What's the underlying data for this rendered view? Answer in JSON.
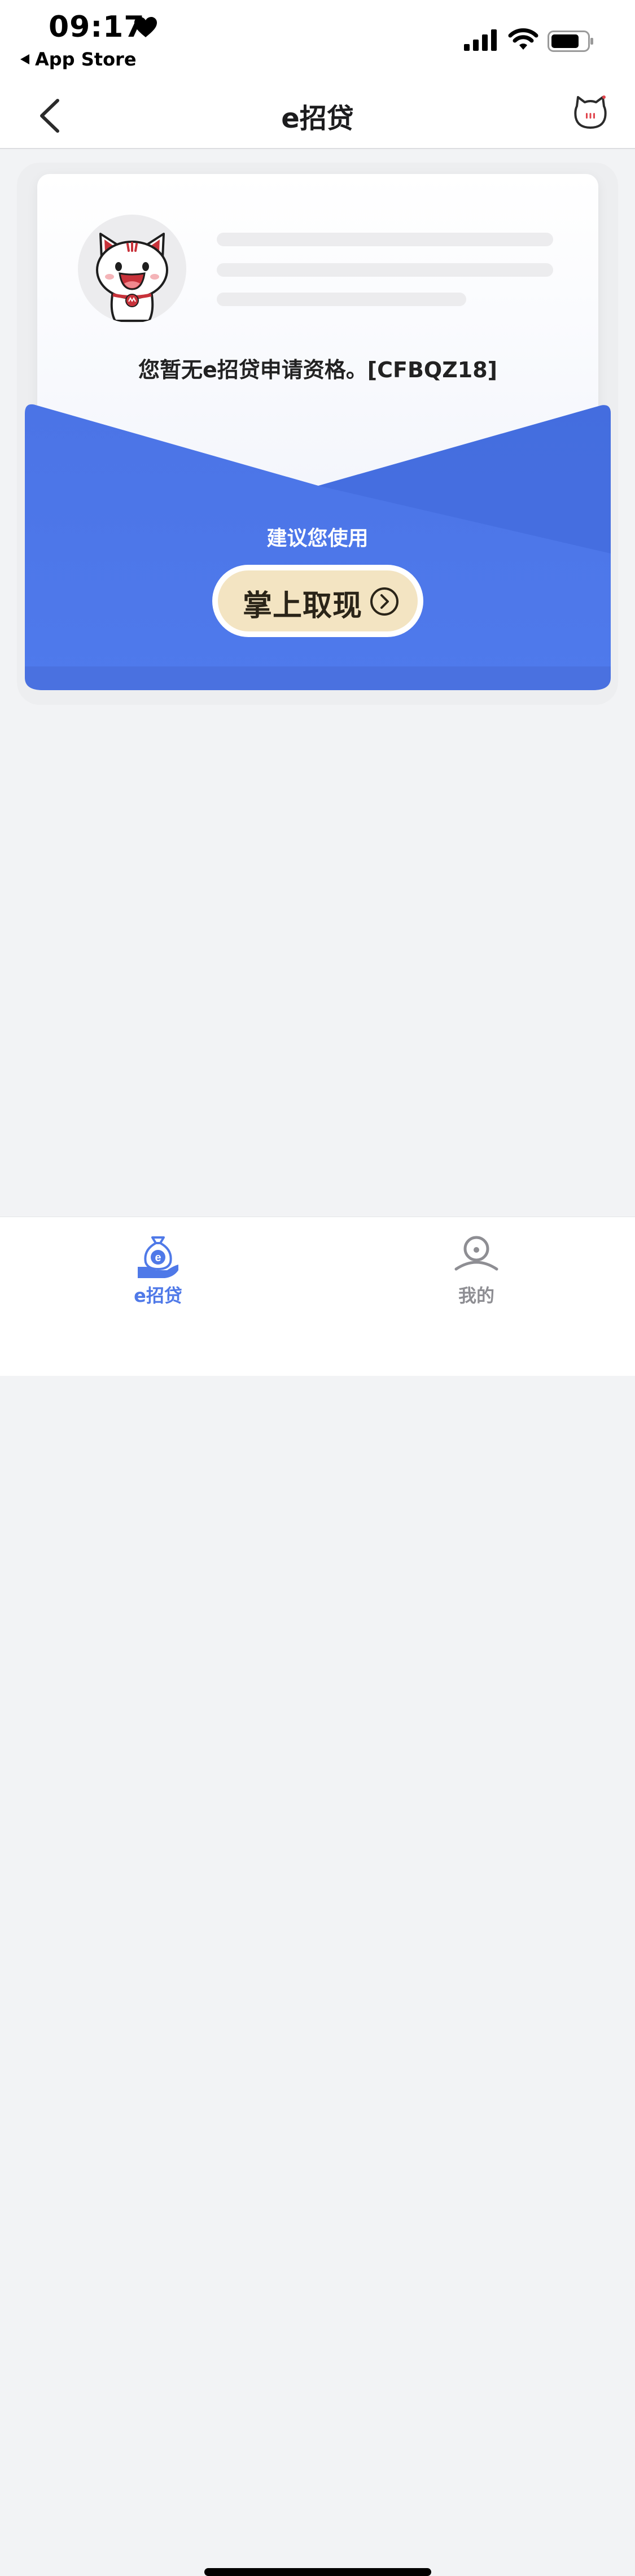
{
  "status_bar": {
    "time": "09:17",
    "back_app": "App Store"
  },
  "nav": {
    "title": "e招贷"
  },
  "card": {
    "notice": "您暂无e招贷申请资格。[CFBQZ18]",
    "suggest": "建议您使用",
    "cta_label": "掌上取现"
  },
  "tabs": [
    {
      "label": "e招贷",
      "active": true
    },
    {
      "label": "我的",
      "active": false
    }
  ],
  "colors": {
    "accent": "#4f79e8",
    "cta_bg": "#f3e4c2",
    "page_bg": "#f2f3f5"
  }
}
